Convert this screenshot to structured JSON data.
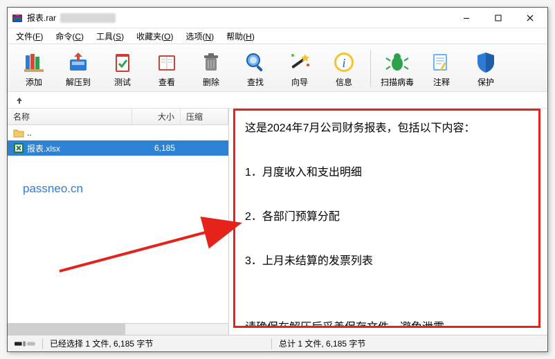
{
  "window": {
    "title": "报表.rar"
  },
  "menu": {
    "file": {
      "text": "文件",
      "accel": "F"
    },
    "cmd": {
      "text": "命令",
      "accel": "C"
    },
    "tools": {
      "text": "工具",
      "accel": "S"
    },
    "fav": {
      "text": "收藏夹",
      "accel": "O"
    },
    "opts": {
      "text": "选项",
      "accel": "N"
    },
    "help": {
      "text": "帮助",
      "accel": "H"
    }
  },
  "toolbar": {
    "add": "添加",
    "extract": "解压到",
    "test": "测试",
    "view": "查看",
    "delete": "删除",
    "find": "查找",
    "wizard": "向导",
    "info": "信息",
    "virus": "扫描病毒",
    "comment": "注释",
    "protect": "保护"
  },
  "columns": {
    "name": "名称",
    "size": "大小",
    "comp": "压缩"
  },
  "rows": [
    {
      "kind": "folder",
      "name": "..",
      "size": ""
    },
    {
      "kind": "xlsx",
      "name": "报表.xlsx",
      "size": "6,185"
    }
  ],
  "watermark": "passneo.cn",
  "comment": "这是2024年7月公司财务报表，包括以下内容：\n\n1．月度收入和支出明细\n\n2．各部门预算分配\n\n3．上月未结算的发票列表\n\n\n请确保在解压后妥善保存文件，避免泄露。",
  "status": {
    "left": "已经选择 1 文件, 6,185 字节",
    "right": "总计 1 文件, 6,185 字节"
  }
}
